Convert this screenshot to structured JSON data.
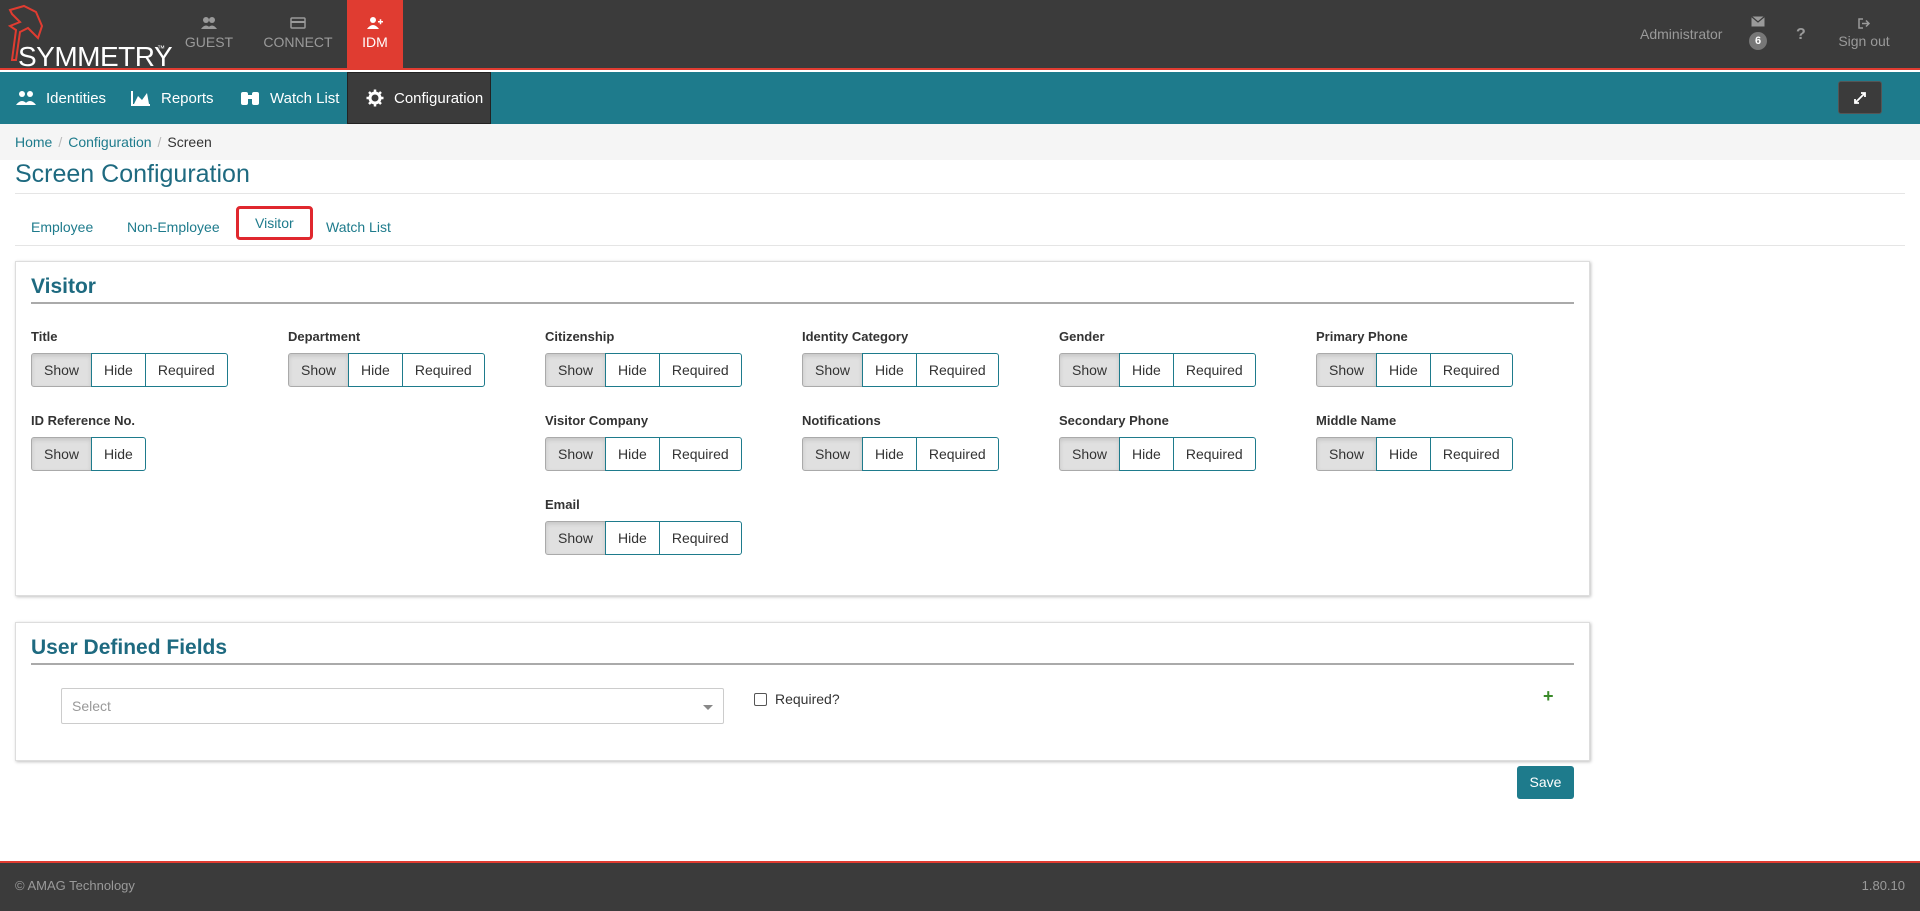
{
  "brand": {
    "name": "SYMMETRY",
    "tm": "™"
  },
  "app_tabs": [
    {
      "label": "GUEST",
      "icon": "users-icon"
    },
    {
      "label": "CONNECT",
      "icon": "card-icon"
    },
    {
      "label": "IDM",
      "icon": "user-plus-icon",
      "active": true
    }
  ],
  "user": {
    "name": "Administrator",
    "messages_count": "6",
    "help": "?",
    "sign_out": "Sign out"
  },
  "nav": [
    {
      "label": "Identities",
      "icon": "users-icon"
    },
    {
      "label": "Reports",
      "icon": "area-chart-icon"
    },
    {
      "label": "Watch List",
      "icon": "binoculars-icon"
    },
    {
      "label": "Configuration",
      "icon": "gear-icon",
      "active": true
    }
  ],
  "breadcrumb": {
    "home": "Home",
    "configuration": "Configuration",
    "current": "Screen",
    "sep": "/"
  },
  "page_title": "Screen Configuration",
  "tabs": [
    "Employee",
    "Non-Employee",
    "Visitor",
    "Watch List"
  ],
  "selected_tab": "Visitor",
  "visitor_panel": {
    "title": "Visitor",
    "fields": {
      "title": {
        "label": "Title",
        "value": "Show"
      },
      "department": {
        "label": "Department",
        "value": "Show"
      },
      "citizenship": {
        "label": "Citizenship",
        "value": "Show"
      },
      "identity_category": {
        "label": "Identity Category",
        "value": "Show"
      },
      "gender": {
        "label": "Gender",
        "value": "Show"
      },
      "primary_phone": {
        "label": "Primary Phone",
        "value": "Show"
      },
      "id_reference": {
        "label": "ID Reference No.",
        "value": "Show"
      },
      "visitor_company": {
        "label": "Visitor Company",
        "value": "Show"
      },
      "notifications": {
        "label": "Notifications",
        "value": "Show"
      },
      "secondary_phone": {
        "label": "Secondary Phone",
        "value": "Show"
      },
      "middle_name": {
        "label": "Middle Name",
        "value": "Show"
      },
      "email": {
        "label": "Email",
        "value": "Show"
      }
    },
    "options": {
      "show": "Show",
      "hide": "Hide",
      "required": "Required"
    }
  },
  "udf_panel": {
    "title": "User Defined Fields",
    "select_placeholder": "Select",
    "required_label": "Required?",
    "add": "+"
  },
  "save_label": "Save",
  "footer": {
    "copyright": "© AMAG Technology",
    "version": "1.80.10"
  },
  "colors": {
    "brand_red": "#e03c31",
    "teal": "#1e7b8c",
    "dark": "#3b3b3b"
  }
}
